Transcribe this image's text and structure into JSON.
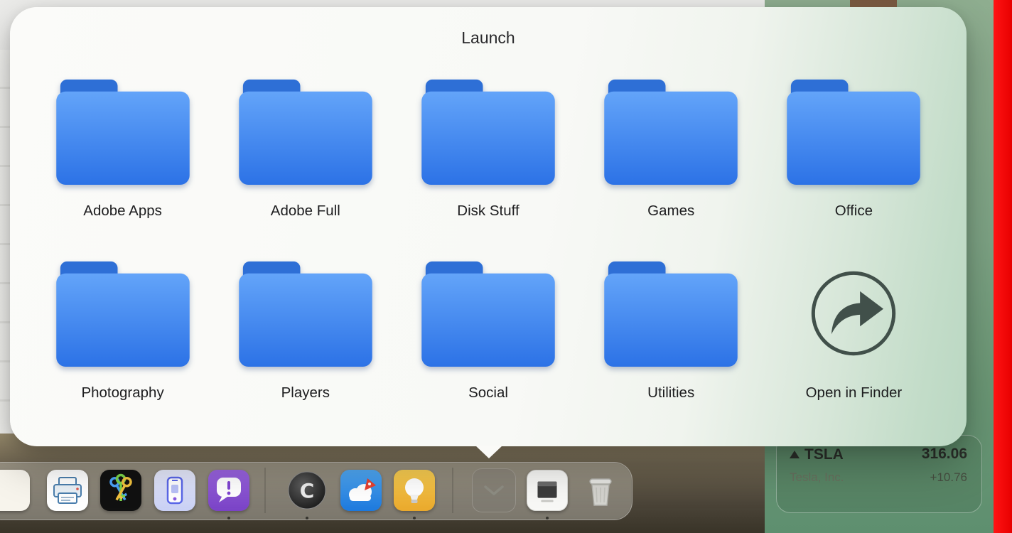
{
  "popup": {
    "title": "Launch",
    "items": [
      {
        "label": "Adobe Apps",
        "type": "folder"
      },
      {
        "label": "Adobe Full",
        "type": "folder"
      },
      {
        "label": "Disk Stuff",
        "type": "folder"
      },
      {
        "label": "Games",
        "type": "folder"
      },
      {
        "label": "Office",
        "type": "folder"
      },
      {
        "label": "Photography",
        "type": "folder"
      },
      {
        "label": "Players",
        "type": "folder"
      },
      {
        "label": "Social",
        "type": "folder"
      },
      {
        "label": "Utilities",
        "type": "folder"
      },
      {
        "label": "Open in Finder",
        "type": "finder-link"
      }
    ]
  },
  "dock": {
    "icons": [
      {
        "name": "partial-app-icon"
      },
      {
        "name": "printer-app-icon"
      },
      {
        "name": "keys-app-icon"
      },
      {
        "name": "phone-app-icon"
      },
      {
        "name": "alert-chat-app-icon"
      },
      {
        "name": "clone-c-app-icon"
      },
      {
        "name": "cloud-transfer-app-icon"
      },
      {
        "name": "lightbulb-app-icon"
      },
      {
        "name": "open-stack-tile"
      },
      {
        "name": "document-app-icon"
      },
      {
        "name": "trash-icon"
      }
    ]
  },
  "widget": {
    "symbol": "TSLA",
    "price": "316.06",
    "company": "Tesla, Inc.",
    "change": "+10.76",
    "direction": "up"
  },
  "colors": {
    "folder_blue_top": "#61a3f8",
    "folder_blue_bottom": "#2d74e8",
    "folder_tab": "#2e6fd6",
    "panel_green": "#7ea485",
    "accent_red": "#e80000"
  }
}
